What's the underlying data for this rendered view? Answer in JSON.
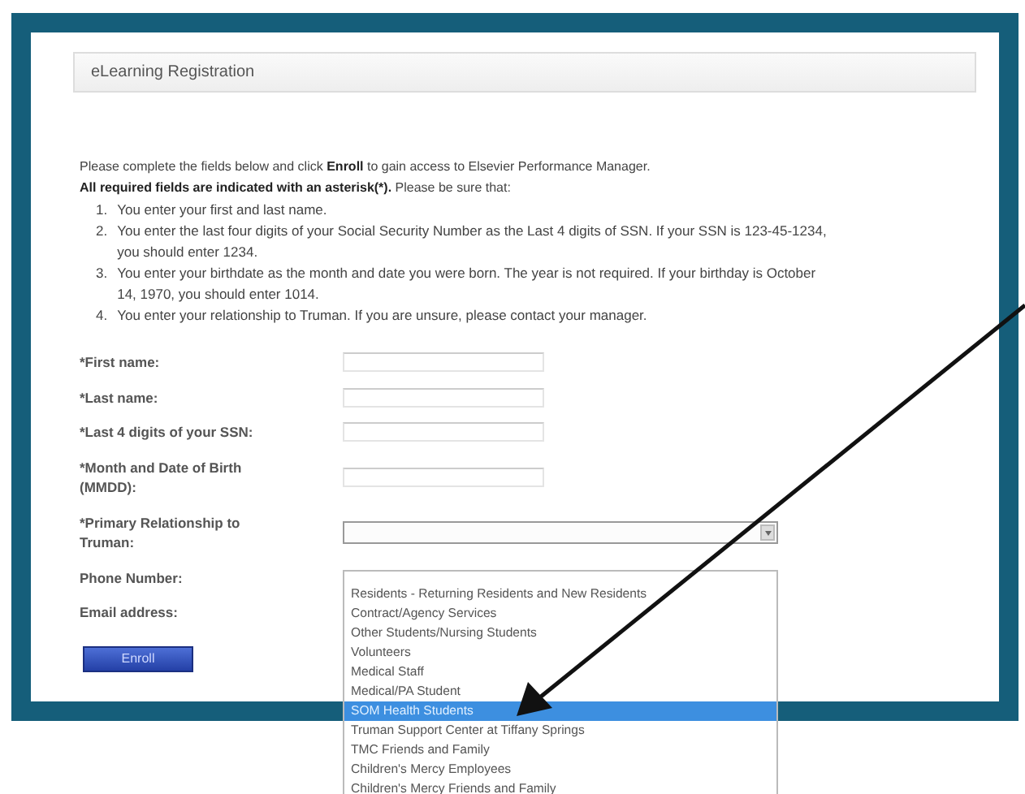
{
  "header": {
    "title": "eLearning Registration"
  },
  "intro": [
    "Please complete the fields below and click **Enroll** to gain access to Elsevier Performance Manager.",
    "**All required fields are indicated with an asterisk(*).** Please be sure that:"
  ],
  "instructions": [
    {
      "number": "1.",
      "text": "You enter your first and last name."
    },
    {
      "number": "2.",
      "text": "You enter the last four digits of your Social Security Number as the Last 4 digits of SSN.  If your SSN is 123-45-1234, you should enter 1234."
    },
    {
      "number": "3.",
      "text": "You enter your birthdate as the month and date you were born.  The year is not required.  If your birthday is October 14, 1970, you should enter 1014."
    },
    {
      "number": "4.",
      "text": "You enter your relationship to Truman. If you are unsure, please contact your manager."
    }
  ],
  "fields": [
    {
      "label": "*First name:",
      "kind": "text"
    },
    {
      "label": "*Last name:",
      "kind": "text"
    },
    {
      "label": "*Last 4 digits of your SSN:",
      "kind": "text"
    },
    {
      "label": "*Month and Date of Birth (MMDD):",
      "kind": "text"
    },
    {
      "label": "*Primary Relationship to Truman:",
      "kind": "select",
      "expanded": true,
      "options": [
        {
          "label": "Residents - Returning Residents and New Residents",
          "selected": false
        },
        {
          "label": "Contract/Agency Services",
          "selected": false
        },
        {
          "label": "Other Students/Nursing Students",
          "selected": false
        },
        {
          "label": "Volunteers",
          "selected": false
        },
        {
          "label": "Medical Staff",
          "selected": false
        },
        {
          "label": "Medical/PA Student",
          "selected": false
        },
        {
          "label": "SOM Health Students",
          "selected": true
        },
        {
          "label": "Truman Support Center at Tiffany Springs",
          "selected": false
        },
        {
          "label": "TMC Friends and Family",
          "selected": false
        },
        {
          "label": "Children's Mercy Employees",
          "selected": false
        },
        {
          "label": "Children's Mercy Friends and Family",
          "selected": false
        }
      ]
    },
    {
      "label": "Phone Number:",
      "kind": "hidden"
    },
    {
      "label": "Email address:",
      "kind": "hidden"
    }
  ],
  "button": {
    "label": "Enroll"
  }
}
